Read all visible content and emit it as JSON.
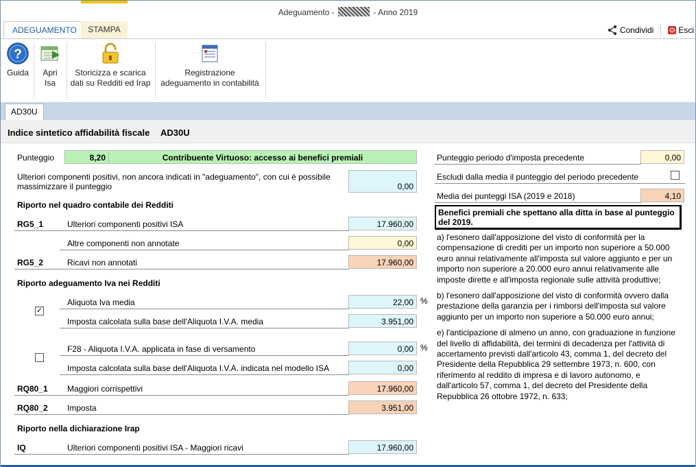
{
  "window": {
    "title_prefix": "Adeguamento -",
    "title_suffix": "Anno 2019"
  },
  "ribbon_tabs": [
    {
      "label": "ADEGUAMENTO"
    },
    {
      "label": "STAMPA"
    }
  ],
  "actions": {
    "share": "Condividi",
    "exit": "Esci"
  },
  "ribbon": {
    "guida": "Guida",
    "apri_isa": [
      "Apri",
      "Isa"
    ],
    "storicizza": [
      "Storicizza e scarica",
      "dati su Redditi ed Irap"
    ],
    "registrazione": [
      "Registrazione",
      "adeguamento in contabilità"
    ]
  },
  "subtab": "AD30U",
  "header": {
    "title": "Indice sintetico affidabilità fiscale",
    "code": "AD30U"
  },
  "left": {
    "punteggio_label": "Punteggio",
    "punteggio_value": "8,20",
    "punteggio_desc": "Contribuente Virtuoso: accesso ai benefici premiali",
    "ulteriori_label_1": "Ulteriori componenti positivi, non ancora indicati in \"adeguamento\", con cui è possibile",
    "ulteriori_label_2": "massimizzare il punteggio",
    "ulteriori_value": "0,00",
    "sec_redditi": "Riporto nel quadro contabile dei Redditi",
    "rg5_1_code": "RG5_1",
    "rg5_1_label": "Ulteriori componenti positivi ISA",
    "rg5_1_value": "17.960,00",
    "altre_label": "Altre componenti non annotate",
    "altre_value": "0,00",
    "rg5_2_code": "RG5_2",
    "rg5_2_label": "Ricavi non annotati",
    "rg5_2_value": "17.960,00",
    "sec_iva": "Riporto adeguamento Iva nei Redditi",
    "aliquota_label": "Aliquota Iva media",
    "aliquota_value": "22,00",
    "percent": "%",
    "imposta_media_label": "Imposta calcolata sulla base dell'Aliquota I.V.A. media",
    "imposta_media_value": "3.951,00",
    "f28_label": "F28 - Aliquota I.V.A. applicata in fase di versamento",
    "f28_value": "0,00",
    "imposta_isa_label": "Imposta calcolata sulla base dell'Aliquota I.V.A. indicata nel modello ISA",
    "imposta_isa_value": "0,00",
    "rq80_1_code": "RQ80_1",
    "rq80_1_label": "Maggiori corrispettivi",
    "rq80_1_value": "17.960,00",
    "rq80_2_code": "RQ80_2",
    "rq80_2_label": "Imposta",
    "rq80_2_value": "3.951,00",
    "sec_irap": "Riporto nella dichiarazione Irap",
    "iq_code": "IQ",
    "iq_label": "Ulteriori componenti positivi ISA - Maggiori ricavi",
    "iq_value": "17.960,00",
    "check_media_mark": "✓",
    "check_f28_mark": ""
  },
  "right": {
    "prec_label": "Punteggio periodo d'imposta precedente",
    "prec_value": "0,00",
    "escludi_label": "Escludi dalla media il punteggio del periodo precedente",
    "media_label": "Media dei punteggi ISA (2019 e 2018)",
    "media_value": "4,10",
    "benefits_title": "Benefici premiali che spettano alla ditta in base al punteggio del 2019.",
    "benefit_a": "a) l'esonero dall'apposizione del visto di conformità per la compensazione di crediti per un importo non superiore a 50.000 euro annui relativamente all'imposta sul valore aggiunto e per un importo non superiore a 20.000 euro annui relativamente alle imposte dirette e all'imposta regionale sulle attività produttive;",
    "benefit_b": "b) l'esonero dall'apposizione del visto di conformità ovvero dalla prestazione della garanzia per i rimborsi dell'imposta sul valore aggiunto per un importo non superiore a 50.000 euro annui;",
    "benefit_e": "e) l'anticipazione di almeno un anno, con graduazione in funzione del livello di affidabilità, dei termini di decadenza per l'attività di accertamento previsti dall'articolo 43, comma 1, del decreto del Presidente della Repubblica 29 settembre 1973, n. 600, con riferimento al reddito di impresa e di lavoro autonomo, e dall'articolo 57, comma 1, del decreto del Presidente della Repubblica 26 ottobre 1972, n. 633;"
  },
  "colors": {
    "accent_blue": "#1f5fa8",
    "cyan_field": "#def5fb",
    "yellow_field": "#fff7d6",
    "orange_field": "#f9d3b8",
    "green_field": "#b8f2b6"
  }
}
